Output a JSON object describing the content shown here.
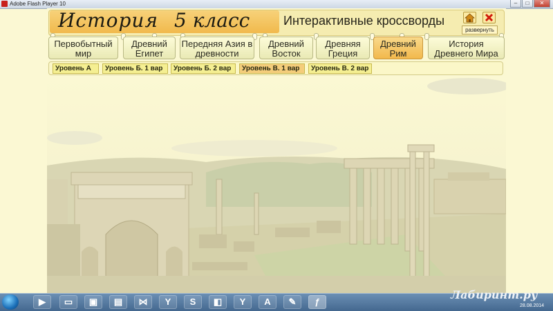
{
  "window": {
    "title": "Adobe Flash Player 10",
    "min": "–",
    "max": "□",
    "close": "✕"
  },
  "header": {
    "title": "История",
    "grade": "5 класс",
    "subtitle": "Интерактивные кроссворды",
    "expand_label": "развернуть"
  },
  "tabs": [
    {
      "label": "Первобытный мир",
      "active": false
    },
    {
      "label": "Древний Египет",
      "active": false
    },
    {
      "label": "Передняя Азия в древности",
      "active": false
    },
    {
      "label": "Древний Восток",
      "active": false
    },
    {
      "label": "Древняя Греция",
      "active": false
    },
    {
      "label": "Древний Рим",
      "active": true
    },
    {
      "label": "История Древнего Мира",
      "active": false
    }
  ],
  "levels": [
    {
      "label": "Уровень А",
      "active": false
    },
    {
      "label": "Уровень Б. 1 вар",
      "active": false
    },
    {
      "label": "Уровень Б. 2 вар",
      "active": false
    },
    {
      "label": "Уровень В. 1 вар",
      "active": true
    },
    {
      "label": "Уровень В. 2 вар",
      "active": false
    }
  ],
  "taskbar": {
    "items": [
      "media-icon",
      "folder-icon",
      "network-icon",
      "calculator-icon",
      "visual-studio-icon",
      "yandex-icon",
      "skype-icon",
      "files-icon",
      "yandex-icon",
      "acrobat-icon",
      "paint-icon",
      "flash-icon"
    ]
  },
  "watermark": "Лабиринт.ру",
  "date": "28.08.2014",
  "colors": {
    "accent": "#f2b84c",
    "background": "#fbf8d3"
  }
}
